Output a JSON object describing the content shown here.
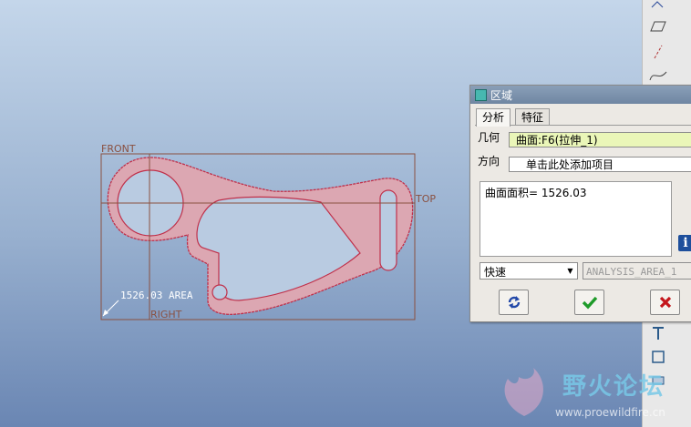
{
  "viewport": {
    "datum_labels": {
      "front": "FRONT",
      "top": "TOP",
      "right": "RIGHT"
    },
    "area_annotation": "1526.03 AREA"
  },
  "dialog": {
    "title": "区域",
    "tabs": [
      {
        "label": "分析"
      },
      {
        "label": "特征"
      }
    ],
    "geometry_label": "几何",
    "geometry_value": "曲面:F6(拉伸_1)",
    "direction_label": "方向",
    "direction_value": "单击此处添加项目",
    "result_text": "曲面面积= 1526.03",
    "mode_value": "快速",
    "analysis_name": "ANALYSIS_AREA_1"
  },
  "watermark": {
    "title": "野火论坛",
    "url": "www.proewildfire.cn"
  },
  "colors": {
    "part_fill": "#dca7b2",
    "part_edge": "#c0304a",
    "datum": "#8a5040",
    "accept": "#1f9b2a",
    "cancel": "#c4161c",
    "geometry_field_bg": "#eaf6b8"
  }
}
